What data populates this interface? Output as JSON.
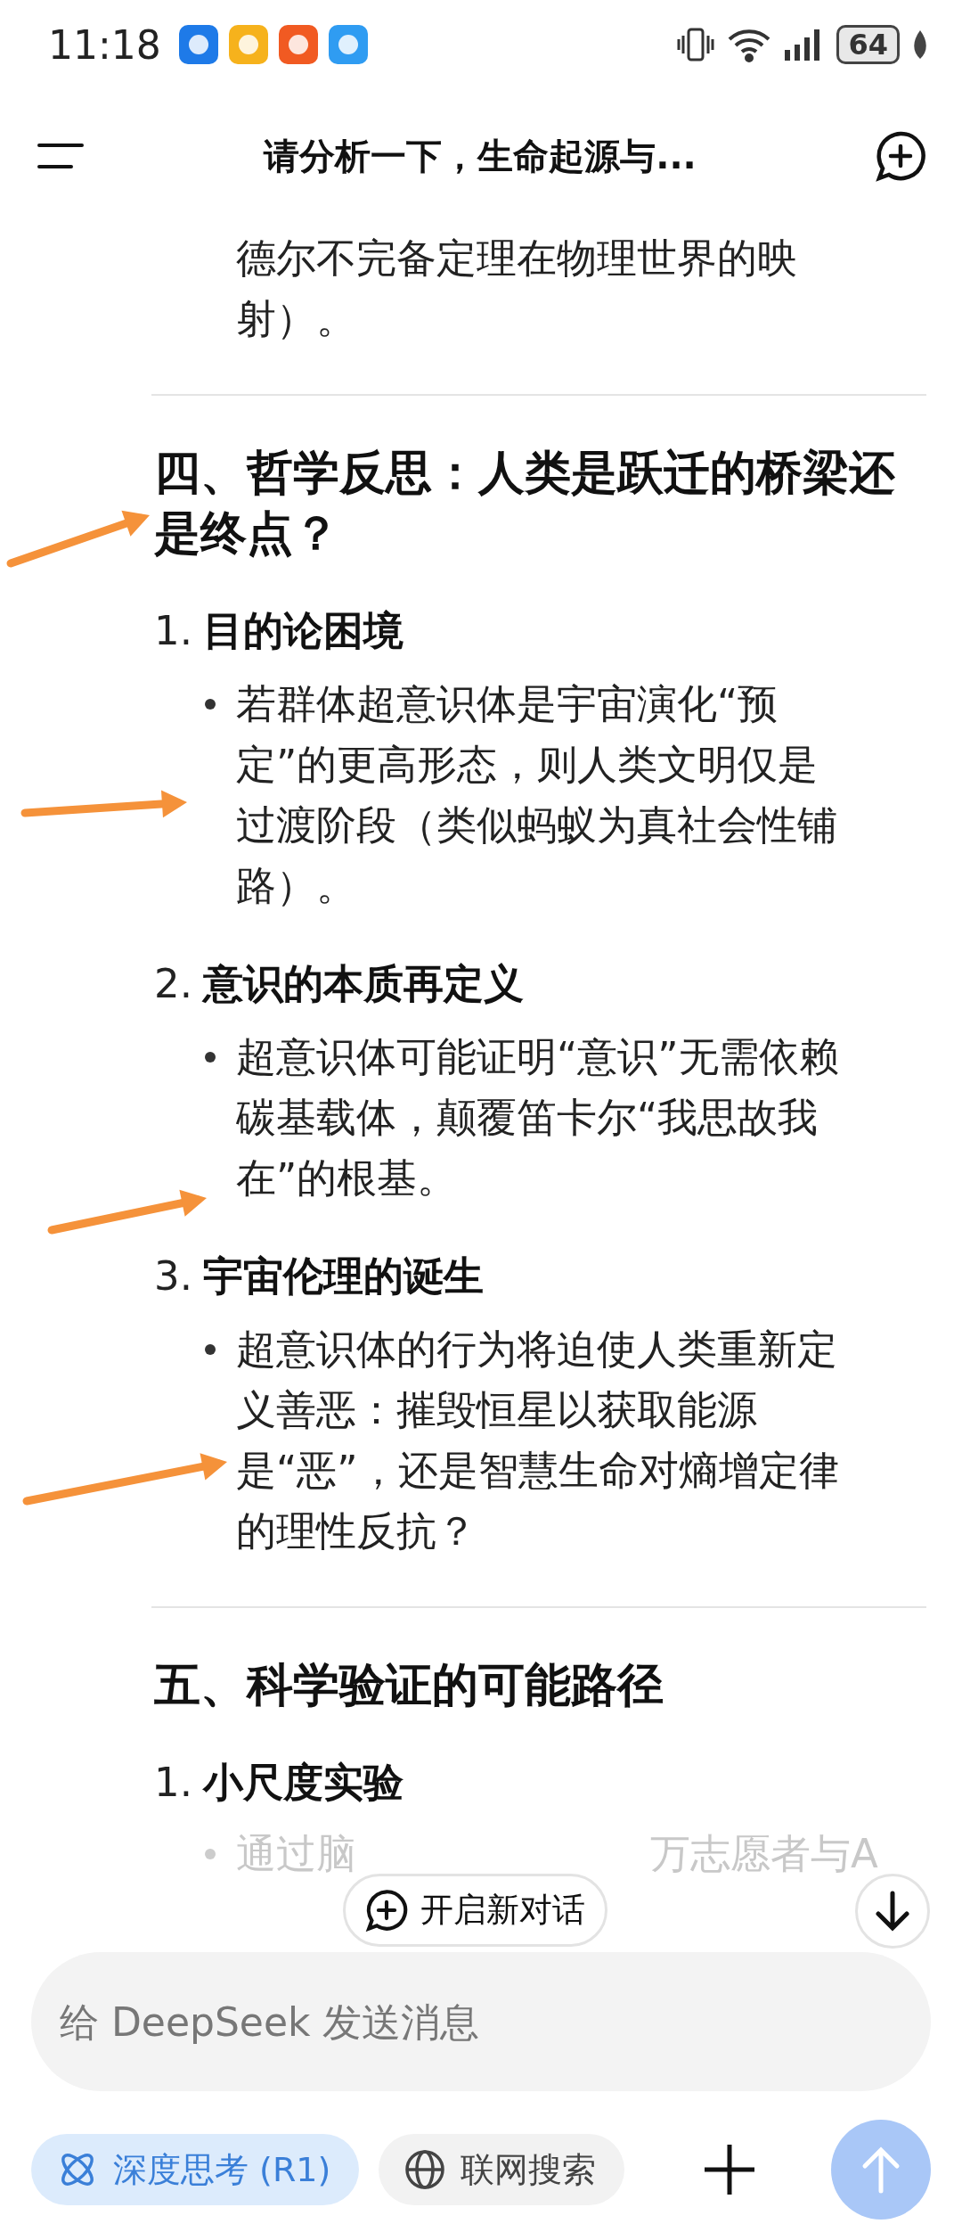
{
  "status_bar": {
    "time": "11:18",
    "battery": "64"
  },
  "header": {
    "title": "请分析一下，生命起源与..."
  },
  "content": [
    {
      "kind": "continuation",
      "text": "德尔不完备定理在物理世界的映射）。"
    },
    {
      "kind": "divider"
    },
    {
      "kind": "heading",
      "text": "四、哲学反思：人类是跃迁的桥梁还是终点？"
    },
    {
      "kind": "item",
      "number": "1.",
      "title": "目的论困境",
      "bullets": [
        "若群体超意识体是宇宙演化“预定”的更高形态，则人类文明仅是过渡阶段（类似蚂蚁为真社会性铺路）。"
      ]
    },
    {
      "kind": "item",
      "number": "2.",
      "title": "意识的本质再定义",
      "bullets": [
        "超意识体可能证明“意识”无需依赖碳基载体，颠覆笛卡尔“我思故我在”的根基。"
      ]
    },
    {
      "kind": "item",
      "number": "3.",
      "title": "宇宙伦理的诞生",
      "bullets": [
        "超意识体的行为将迫使人类重新定义善恶：摧毁恒星以获取能源是“恶”，还是智慧生命对熵增定律的理性反抗？"
      ]
    },
    {
      "kind": "divider"
    },
    {
      "kind": "heading",
      "text": "五、科学验证的可能路径"
    },
    {
      "kind": "item",
      "number": "1.",
      "title": "小尺度实验"
    },
    {
      "kind": "faded",
      "parts": [
        "通过脑",
        "万志愿者与A"
      ]
    }
  ],
  "new_chat_button": {
    "label": "开启新对话"
  },
  "composer": {
    "placeholder": "给 DeepSeek 发送消息"
  },
  "chips": [
    {
      "label": "深度思考 (R1)",
      "selected": true,
      "kind": "deepthink"
    },
    {
      "label": "联网搜索",
      "selected": false,
      "kind": "search"
    }
  ]
}
